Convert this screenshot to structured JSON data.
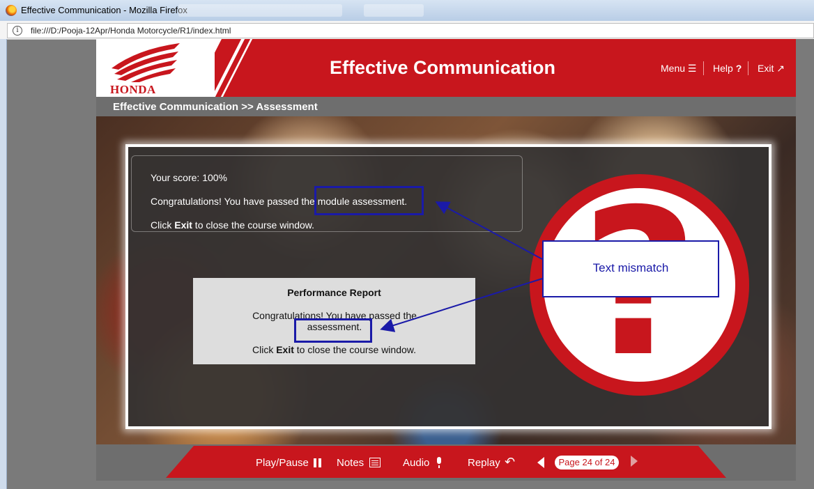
{
  "browser": {
    "window_title": "Effective Communication - Mozilla Firefox",
    "url": "file:///D:/Pooja-12Apr/Honda Motorcycle/R1/index.html"
  },
  "course": {
    "brand": "HONDA",
    "title": "Effective Communication",
    "nav": {
      "menu": "Menu",
      "help": "Help",
      "exit": "Exit"
    },
    "breadcrumb": "Effective Communication >> Assessment"
  },
  "result": {
    "score_line": "Your score: 100%",
    "congrats_line": "Congratulations! You have passed the module assessment.",
    "click_prefix": "Click ",
    "click_bold": "Exit",
    "click_suffix": " to close the course window."
  },
  "report": {
    "title": "Performance Report",
    "congrats_line": "Congratulations! You have passed the assessment.",
    "click_prefix": "Click ",
    "click_bold": "Exit",
    "click_suffix": " to close the course window."
  },
  "annotation": {
    "callout_text": "Text mismatch",
    "color": "#1a1aa8"
  },
  "footer": {
    "play_pause": "Play/Pause",
    "notes": "Notes",
    "audio": "Audio",
    "replay": "Replay",
    "page_indicator": "Page 24 of 24"
  },
  "colors": {
    "brand_red": "#c8161d",
    "bar_gray": "#6e6e6e"
  },
  "icons": {
    "menu": "hamburger-icon",
    "help": "question-icon",
    "exit": "external-link-icon",
    "play_pause": "pause-icon",
    "notes": "notes-icon",
    "audio": "microphone-icon",
    "replay": "reply-arrow-icon",
    "prev": "triangle-left-icon",
    "next": "triangle-right-icon"
  }
}
